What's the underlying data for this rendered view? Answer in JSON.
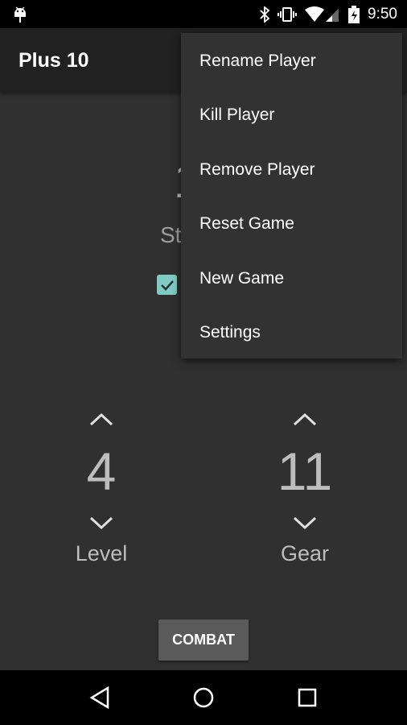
{
  "status_bar": {
    "time": "9:50",
    "icons": [
      "android-icon",
      "bluetooth-icon",
      "vibrate-icon",
      "wifi-icon",
      "signal-icon",
      "battery-charging-icon"
    ]
  },
  "app_bar": {
    "title": "Plus 10"
  },
  "player": {
    "strength_partial": "1",
    "strength_label_partial": "St",
    "checkbox_checked": true,
    "accent": "#80cbc4"
  },
  "level": {
    "value": "4",
    "label": "Level"
  },
  "gear": {
    "value": "11",
    "label": "Gear"
  },
  "combat_label": "COMBAT",
  "menu": {
    "items": [
      "Rename Player",
      "Kill Player",
      "Remove Player",
      "Reset Game",
      "New Game",
      "Settings"
    ]
  }
}
